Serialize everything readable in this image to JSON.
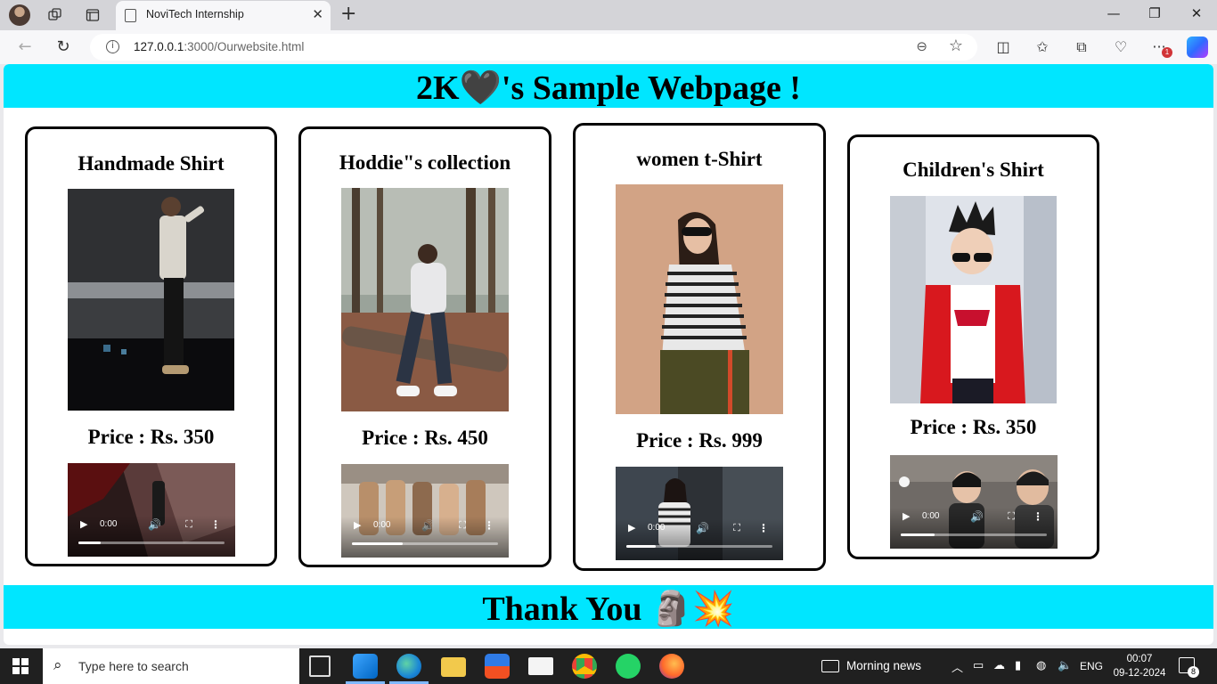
{
  "browser": {
    "tab_title": "NoviTech Internship",
    "tab_close": "✕",
    "new_tab": "+",
    "url_host": "127.0.0.1",
    "url_path": ":3000/Ourwebsite.html",
    "notification_count": "1"
  },
  "page": {
    "header_title": "2K🖤's Sample Webpage !",
    "footer_title": "Thank You 🗿💥",
    "accent_color": "#00e6ff",
    "products": [
      {
        "title": "Handmade Shirt",
        "price": "Price : Rs. 350",
        "video_time": "0:00",
        "video_progress": 0.15,
        "image": "photo-man-striped-shirt"
      },
      {
        "title": "Hoddie\"s collection",
        "price": "Price : Rs. 450",
        "video_time": "0:00",
        "video_progress": 0.35,
        "image": "photo-man-white-hoodie-forest"
      },
      {
        "title": "women t-Shirt",
        "price": "Price : Rs. 999",
        "video_time": "0:00",
        "video_progress": 0.2,
        "image": "photo-woman-striped-top"
      },
      {
        "title": "Children's Shirt",
        "price": "Price : Rs. 350",
        "video_time": "0:00",
        "video_progress": 0.23,
        "image": "photo-boy-red-jacket"
      }
    ]
  },
  "taskbar": {
    "search_placeholder": "Type here to search",
    "weather": "Morning news",
    "language": "ENG",
    "time": "00:07",
    "date": "09-12-2024",
    "notifications": "8"
  }
}
